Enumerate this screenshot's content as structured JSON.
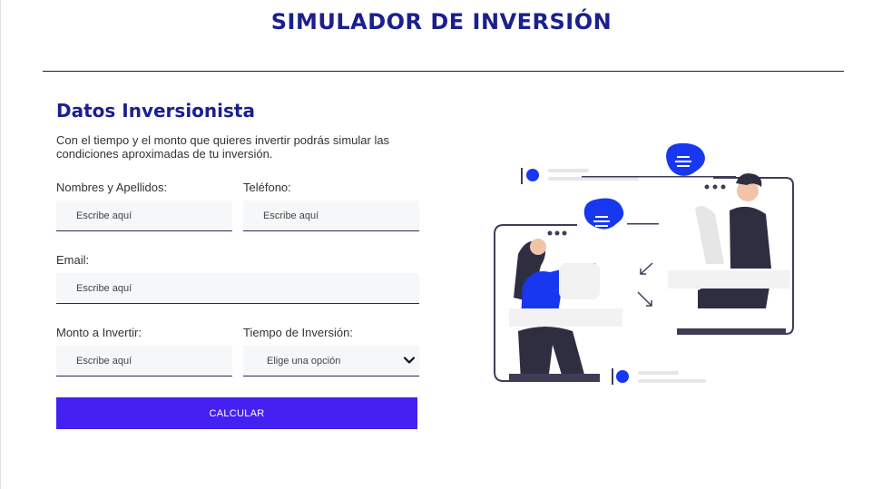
{
  "page": {
    "title": "SIMULADOR DE INVERSIÓN"
  },
  "form": {
    "title": "Datos Inversionista",
    "description": "Con el tiempo y el monto que quieres invertir podrás simular las condiciones aproximadas de tu inversión.",
    "fields": {
      "name": {
        "label": "Nombres y Apellidos:",
        "placeholder": "Escribe aquí",
        "value": ""
      },
      "phone": {
        "label": "Teléfono:",
        "placeholder": "Escribe aquí",
        "value": ""
      },
      "email": {
        "label": "Email:",
        "placeholder": "Escribe aquí",
        "value": ""
      },
      "amount": {
        "label": "Monto a Invertir:",
        "placeholder": "Escribe aquí",
        "value": ""
      },
      "term": {
        "label": "Tiempo de Inversión:",
        "selected": "Elige una opción"
      }
    },
    "submit_label": "CALCULAR"
  },
  "colors": {
    "brand_navy": "#1b1f8f",
    "button": "#4421f2",
    "illustration_blue": "#1737f0",
    "illustration_dark": "#3f3d56"
  },
  "icons": {
    "select": "chevron-down-icon",
    "illustration": "people-chat-illustration"
  }
}
